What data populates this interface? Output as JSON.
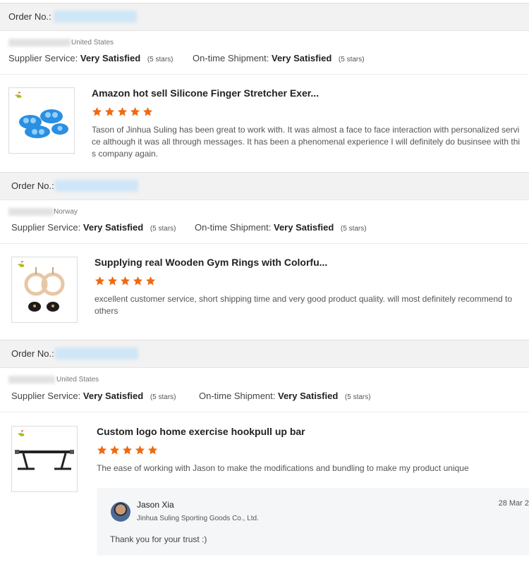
{
  "colors": {
    "star": "#f06a10",
    "header_bg": "#f2f2f2",
    "reply_bg": "#f5f6f8"
  },
  "reviews": [
    {
      "order_label": "Order No.:",
      "country": "United States",
      "supplier_service": {
        "label": "Supplier Service:",
        "value": "Very Satisfied",
        "stars": "(5 stars)"
      },
      "shipment": {
        "label": "On-time Shipment:",
        "value": "Very Satisfied",
        "stars": "(5 stars)"
      },
      "product_title": "Amazon hot sell Silicone Finger Stretcher Exer...",
      "rating": 5,
      "comment": "Tason of Jinhua Suling has been great to work with. It was almost a face to face interaction with personalized service although it was all through messages. It has been a phenomenal experience I will definitely do businsee with this company again.",
      "image_icon": "blue-silicone-finger-stretchers-image"
    },
    {
      "order_label": "Order No.:",
      "country": "Norway",
      "supplier_service": {
        "label": "Supplier Service:",
        "value": "Very Satisfied",
        "stars": "(5 stars)"
      },
      "shipment": {
        "label": "On-time Shipment:",
        "value": "Very Satisfied",
        "stars": "(5 stars)"
      },
      "product_title": "Supplying real Wooden Gym Rings with Colorfu...",
      "rating": 5,
      "comment": "excellent customer service, short shipping time and very good product quality. will most definitely recommend to others",
      "image_icon": "wooden-gym-rings-image"
    },
    {
      "order_label": "Order No.:",
      "country": "United States",
      "supplier_service": {
        "label": "Supplier Service:",
        "value": "Very Satisfied",
        "stars": "(5 stars)"
      },
      "shipment": {
        "label": "On-time Shipment:",
        "value": "Very Satisfied",
        "stars": "(5 stars)"
      },
      "product_title": "Custom logo home exercise hookpull up bar",
      "rating": 5,
      "comment": "The ease of working with Jason to make the modifications and bundling to make my product unique",
      "image_icon": "pull-up-bar-image"
    }
  ],
  "reply": {
    "name": "Jason Xia",
    "company": "Jinhua Suling Sporting Goods Co., Ltd.",
    "date": "28 Mar 2",
    "text": "Thank you for your trust :)"
  }
}
